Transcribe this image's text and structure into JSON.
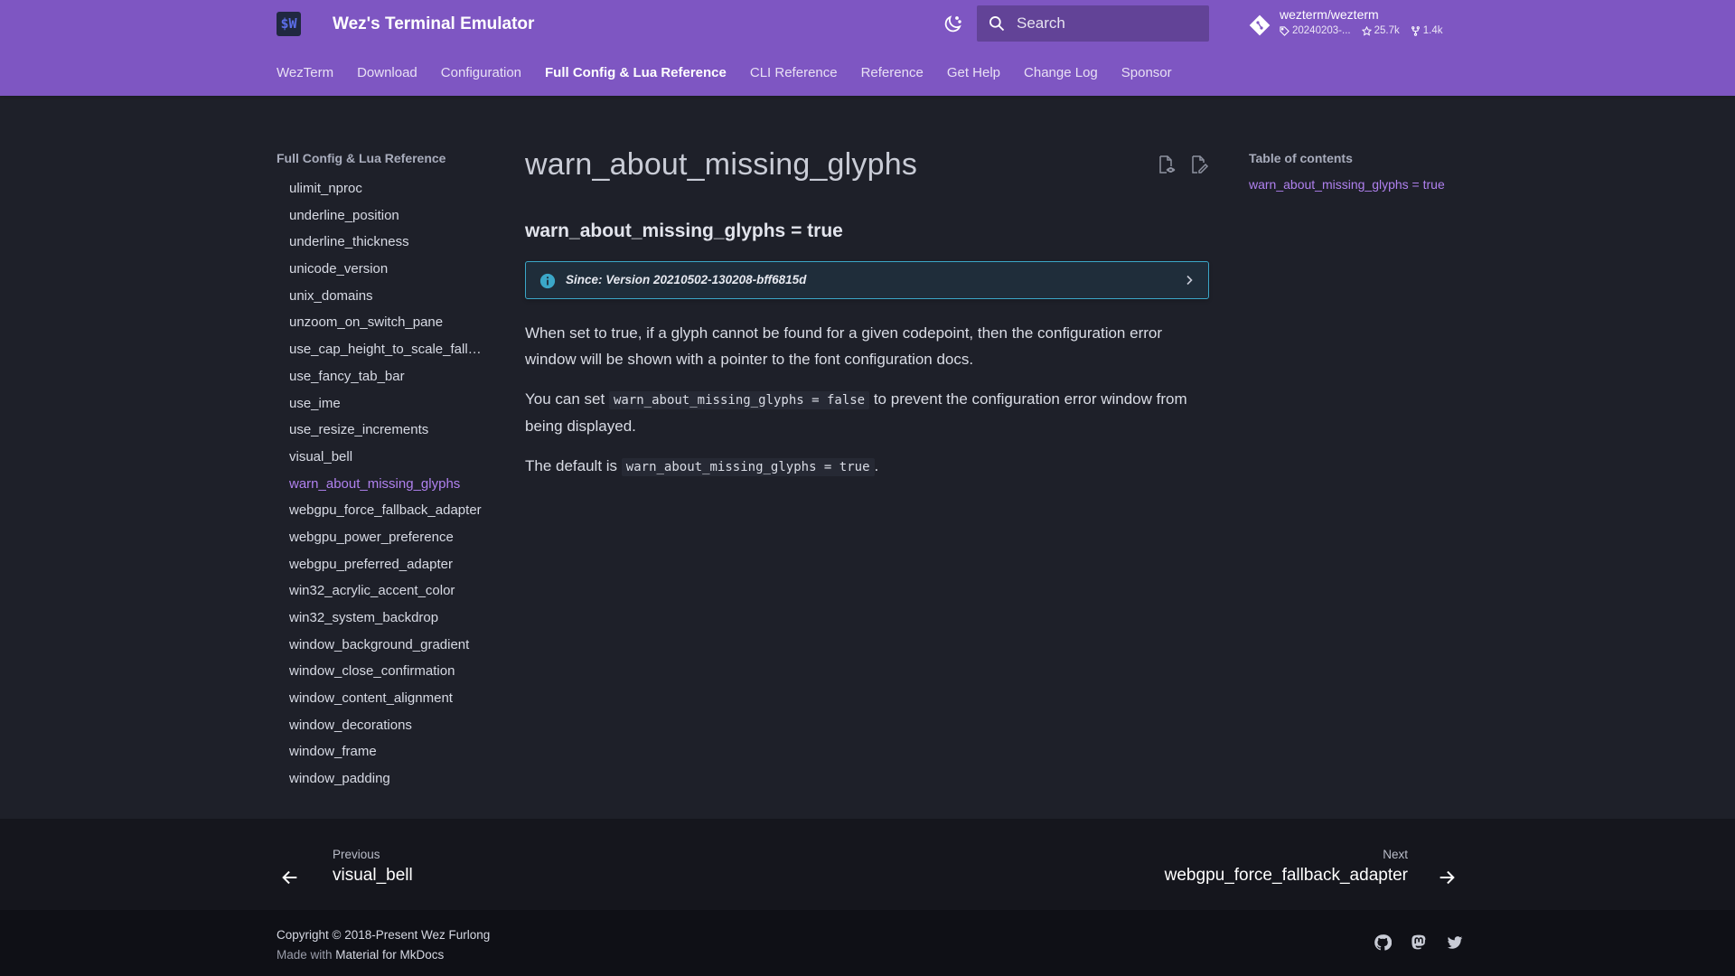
{
  "header": {
    "logo_text": "$W",
    "site_title": "Wez's Terminal Emulator",
    "search_placeholder": "Search",
    "repo": {
      "name": "wezterm/wezterm",
      "version": "20240203-...",
      "stars": "25.7k",
      "forks": "1.4k"
    },
    "tabs": [
      {
        "label": "WezTerm",
        "active": false
      },
      {
        "label": "Download",
        "active": false
      },
      {
        "label": "Configuration",
        "active": false
      },
      {
        "label": "Full Config & Lua Reference",
        "active": true
      },
      {
        "label": "CLI Reference",
        "active": false
      },
      {
        "label": "Reference",
        "active": false
      },
      {
        "label": "Get Help",
        "active": false
      },
      {
        "label": "Change Log",
        "active": false
      },
      {
        "label": "Sponsor",
        "active": false
      }
    ]
  },
  "sidebar": {
    "title": "Full Config & Lua Reference",
    "items": [
      {
        "label": "ulimit_nproc"
      },
      {
        "label": "underline_position"
      },
      {
        "label": "underline_thickness"
      },
      {
        "label": "unicode_version"
      },
      {
        "label": "unix_domains"
      },
      {
        "label": "unzoom_on_switch_pane"
      },
      {
        "label": "use_cap_height_to_scale_fallback_fonts"
      },
      {
        "label": "use_fancy_tab_bar"
      },
      {
        "label": "use_ime"
      },
      {
        "label": "use_resize_increments"
      },
      {
        "label": "visual_bell"
      },
      {
        "label": "warn_about_missing_glyphs",
        "active": true
      },
      {
        "label": "webgpu_force_fallback_adapter"
      },
      {
        "label": "webgpu_power_preference"
      },
      {
        "label": "webgpu_preferred_adapter"
      },
      {
        "label": "win32_acrylic_accent_color"
      },
      {
        "label": "win32_system_backdrop"
      },
      {
        "label": "window_background_gradient"
      },
      {
        "label": "window_close_confirmation"
      },
      {
        "label": "window_content_alignment"
      },
      {
        "label": "window_decorations"
      },
      {
        "label": "window_frame"
      },
      {
        "label": "window_padding"
      }
    ]
  },
  "content": {
    "title": "warn_about_missing_glyphs",
    "heading": "warn_about_missing_glyphs = true",
    "admonition": "Since: Version 20210502-130208-bff6815d",
    "p1": "When set to true, if a glyph cannot be found for a given codepoint, then the configuration error window will be shown with a pointer to the font configuration docs.",
    "p2_before": "You can set ",
    "p2_code": "warn_about_missing_glyphs = false",
    "p2_after": " to prevent the configuration error window from being displayed.",
    "p3_before": "The default is ",
    "p3_code": "warn_about_missing_glyphs = true",
    "p3_after": "."
  },
  "toc": {
    "title": "Table of contents",
    "items": [
      {
        "label": "warn_about_missing_glyphs = true"
      }
    ]
  },
  "footer": {
    "prev_direction": "Previous",
    "prev_title": "visual_bell",
    "next_direction": "Next",
    "next_title": "webgpu_force_fallback_adapter",
    "copyright": "Copyright © 2018-Present Wez Furlong",
    "made_with_prefix": "Made with ",
    "made_with_link": "Material for MkDocs"
  },
  "colors": {
    "header": "#7e56c2",
    "background": "#1e2029",
    "accent": "#b081ef",
    "info": "#3ba7c8"
  },
  "icons": [
    "logo-icon",
    "theme-toggle-icon",
    "search-icon",
    "git-icon",
    "tag-icon",
    "star-icon",
    "fork-icon",
    "view-source-icon",
    "edit-icon",
    "info-icon",
    "chevron-right-icon",
    "arrow-left-icon",
    "arrow-right-icon",
    "github-icon",
    "mastodon-icon",
    "twitter-icon"
  ]
}
